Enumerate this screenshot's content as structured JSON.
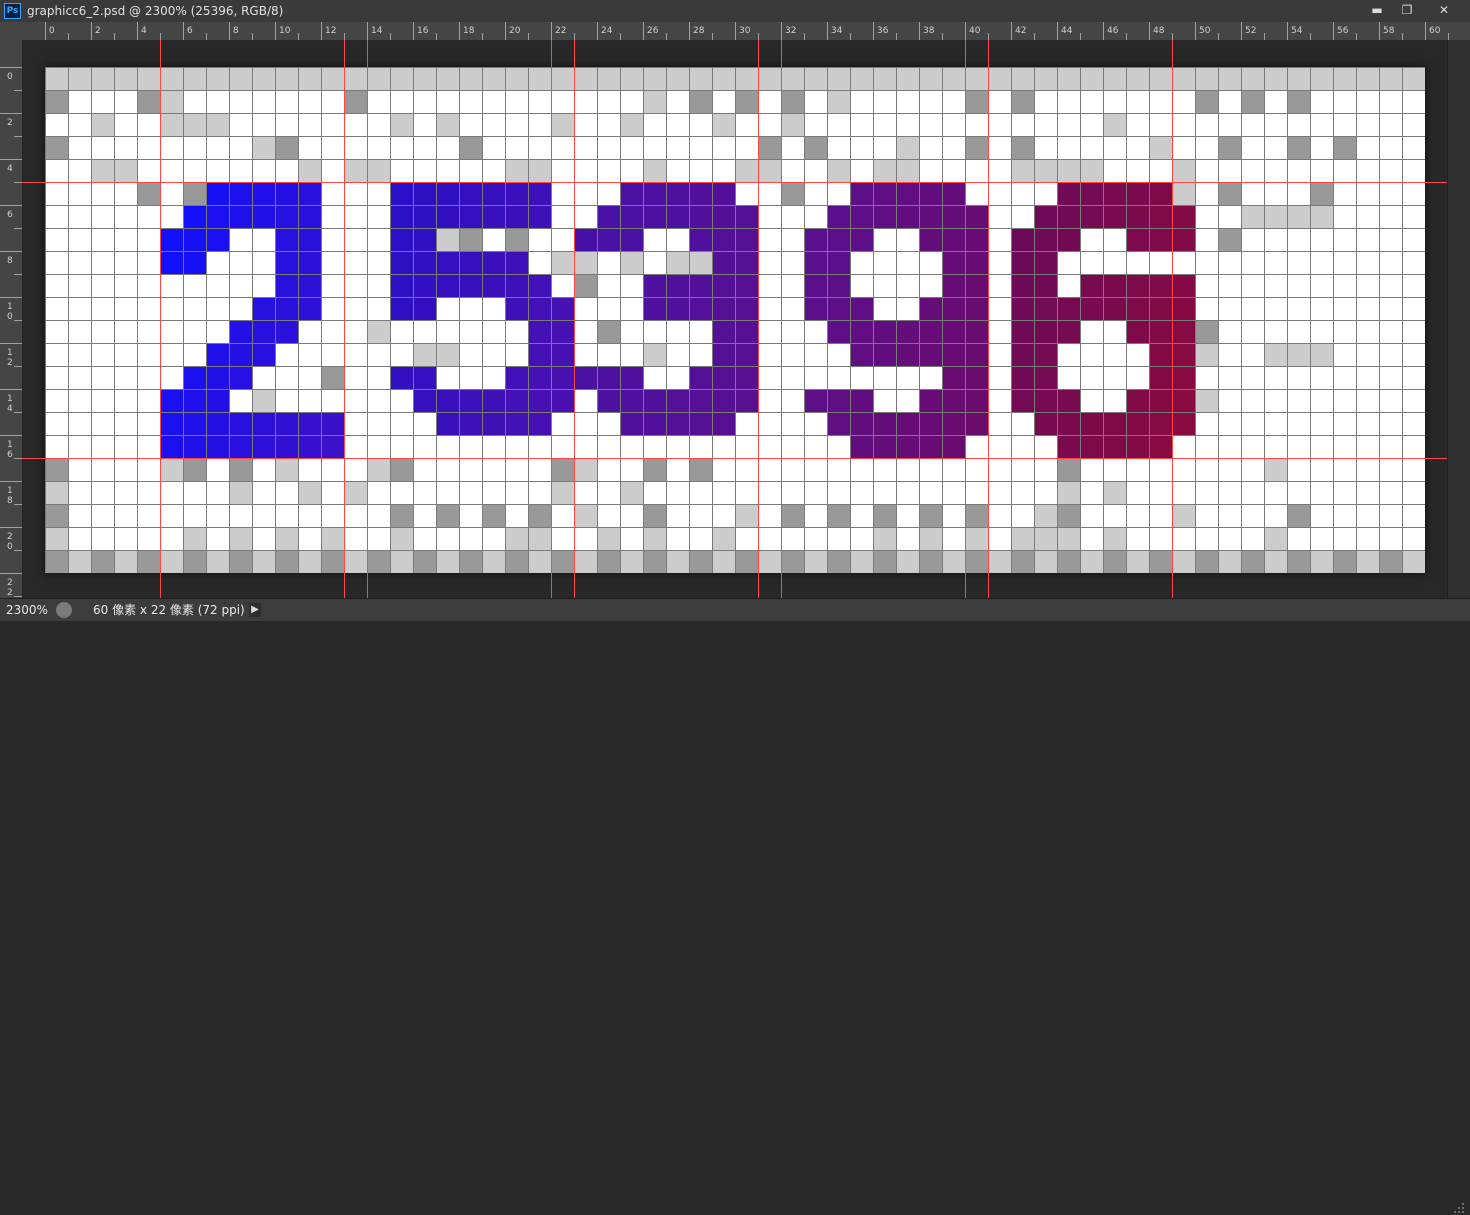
{
  "window": {
    "app_icon": "Ps",
    "title": "graphicc6_2.psd @ 2300% (25396, RGB/8)",
    "buttons": [
      {
        "name": "minimize",
        "icon": "minimize-icon",
        "glyph": "▬"
      },
      {
        "name": "maximize",
        "icon": "maximize-icon",
        "glyph": "❐"
      },
      {
        "name": "close",
        "icon": "close-icon",
        "glyph": "✕"
      }
    ]
  },
  "ruler_top": {
    "labels": [
      "0",
      "2",
      "4",
      "6",
      "8",
      "10",
      "12",
      "14",
      "16",
      "18",
      "20",
      "22",
      "24",
      "26",
      "28",
      "30",
      "32",
      "34",
      "36",
      "38",
      "40",
      "42",
      "44",
      "46",
      "48",
      "50",
      "52",
      "54",
      "56",
      "58",
      "60"
    ]
  },
  "ruler_left": {
    "labels": [
      "0",
      "2",
      "4",
      "6",
      "8",
      "10",
      "12",
      "14",
      "16",
      "18",
      "20",
      "22"
    ]
  },
  "canvas": {
    "columns": 60,
    "rows": 22,
    "guide_color": "#ff4545",
    "vertical_guides": [
      5,
      13,
      14,
      22,
      23,
      31,
      32,
      40,
      41,
      49
    ],
    "horizontal_guides": [
      5,
      17
    ],
    "gray_palette": {
      "w": "#ffffff",
      "l": "#cccccc",
      "m": "#999999"
    },
    "background_rows": [
      "llllllllllllllllllllllllllllllllllllllllllllllllllllllllllll",
      "mwwwmlwwwwwwwmwwwwwwwwwwwwlwmwmwmwlwwwwwmwmwwwwwwwmwmwmwwwww",
      "wwlwwlllwwwwwwwlwlwwwwlwwlwwwlwwlwwwwwwwwwwwwwlwwwwwwwwwwwww",
      "mwwwwwwwwlmwwwwwwwmwwwwwwwwwwwwmwmwwwlwwmwmwwwwwlwwmwwmwmwww",
      "wwllwwwwwwwlwllwwwwwllwwwwlwwwllwwlwllwwwwllllwwwlwwwwwwwwww",
      "wwwwmwmwwwwwwwwwwwwwwwwwwwwwwwwwmwwwwwmwwwwwwwwwwlwmwwwmwwww",
      "wwwwwwwwwwwwwwwwwwwwwwwwwwwwwwwwwwwwwwwwwwwwwwwwwwwwllllwwww",
      "wwwwwwwwwwmwwwwwllmwmwwwwlwwwwwwwwwwwwwwlwwwwwwwwwwmwwwwwwww",
      "wwwwwwwwwwwwwwwwwwwwwwllwlwllwwwwwwwwwwwwwwwwwwwwwwwwwwwwwww",
      "wwwwwwwwwwwwwwwwwwwwwwwmwwwwwwwwwwwwwwwwwwwwwwwwwwwwwwwwwwww",
      "wwwwwwwwwwwwwwwwwwwwwwwwwwwwwwwwwwwwwwwwwwwwwwwwwwwwwwwwwwww",
      "wwwwwwwwwwwwwwlwwwwwwwmwmwwwwwwwwwwwwwwwwwwwwwwwwwmwwwwwwwww",
      "wwwwwwwwwwwwwwwwllwwwwwwwwlwwwwwwwwwwwwwwwwwwwwwwwlwwlllwwww",
      "wwwwwwwwwwwwmwwwwwwwwwwwwwwwwwwwwwwwwwwwwwwwwwwwwwwwwwwwwwww",
      "wwwwwwwwwlwwwwwwwwwwwwwwwwwwwwwwwwwwwwwwwwwwwwwwwwlwwwwwwwww",
      "wwwwwwwwwwwwwwwwwwwwwwwwwwwwwwwwwwwwwwwwwwwwwwwwwwwwwwwwwwww",
      "wwwwwwwwwwwwwwwwwwwwwwwwwwwwwwwwwwwwwwwwwwwwwwwwwwwwwwwwwwww",
      "mwwwwlmwmwlwwwlmwwwwwwmlwwmwmwwwwwwwwwwwwwwwmwwwwwwwwlwwwwww",
      "lwwwwwwwlwwlwlwwwwwwwwlwwlwwwwwwwwwwwwwwwwwwlwlwwwwwwwwwwwww",
      "mwwwwwwwwwwwwwwmwmwmwmwlwwmwwwlwmwmwmwmwmwwlmwwwwlwwwwmwwwww",
      "lwwwwwlwlwlwlwwlwwwwllwwlwlwwlwwwwwwlwlwlwlllwlwwwwwwlwwwwww",
      "mlmlmlmlmlmlmlmlmlmlmlmlmlmlmlmlmlmlmlmlmlmlmlmlmlmlmlmlmlml"
    ],
    "glyphs": [
      {
        "name": "glyph-2",
        "col": 5,
        "row": 5,
        "from": "#1010ff",
        "to": "#3a10c8",
        "rows": [
          "..#####.",
          ".######.",
          "###..##.",
          "##...##.",
          ".....##.",
          "....###.",
          "...###..",
          "..###...",
          ".###....",
          "###.....",
          "########",
          "########"
        ]
      },
      {
        "name": "glyph-5",
        "col": 15,
        "row": 5,
        "from": "#2a10c8",
        "to": "#4a10b0",
        "rows": [
          "#######.",
          "#######.",
          "##......",
          "######..",
          "#######.",
          "##...###",
          "......##",
          "......##",
          "##...###",
          ".#######",
          "..#####."
        ]
      },
      {
        "name": "glyph-3",
        "col": 23,
        "row": 5,
        "from": "#4510a8",
        "to": "#5a1090",
        "rows": [
          "..#####.",
          ".#######",
          "###..###",
          "......##",
          "...#####",
          "...#####",
          "......##",
          "......##",
          "###..###",
          ".#######",
          "..#####."
        ]
      },
      {
        "name": "glyph-9",
        "col": 33,
        "row": 5,
        "from": "#5a1090",
        "to": "#6a0a6a",
        "rows": [
          "..#####.",
          ".#######",
          "###..###",
          "##....##",
          "##....##",
          "###..###",
          ".#######",
          "..######",
          "......##",
          "###..###",
          ".#######",
          "..#####."
        ]
      },
      {
        "name": "glyph-6",
        "col": 42,
        "row": 5,
        "from": "#6a0a5a",
        "to": "#8a0a40",
        "rows": [
          "..#####.",
          ".#######",
          "###..###",
          "##......",
          "##.#####",
          "########",
          "###..###",
          "##....##",
          "##....##",
          "###..###",
          ".#######",
          "..#####."
        ]
      }
    ]
  },
  "status": {
    "zoom": "2300%",
    "info_icon": "document-info-icon",
    "doc_info": "60 像素 x 22 像素 (72 ppi)",
    "menu_arrow": "▶"
  }
}
